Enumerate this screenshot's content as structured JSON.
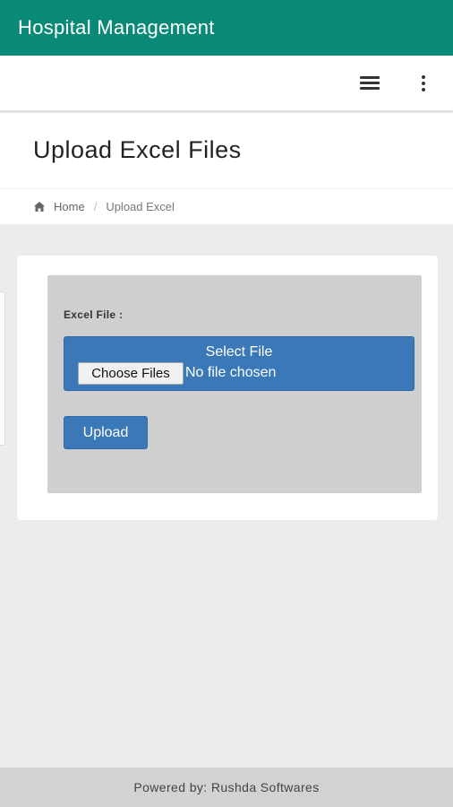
{
  "app_bar": {
    "title": "Hospital Management"
  },
  "toolbar": {
    "menu_icon": "hamburger-menu-icon",
    "more_icon": "more-vertical-icon"
  },
  "page": {
    "title": "Upload Excel Files"
  },
  "breadcrumb": {
    "home_icon": "home-icon",
    "home": "Home",
    "separator": "/",
    "current": "Upload Excel"
  },
  "form": {
    "label": "Excel File :",
    "file_input_title": "Select File",
    "choose_button": "Choose Files",
    "no_file_text": "No file chosen",
    "upload_button": "Upload"
  },
  "footer": {
    "text": "Powered by: Rushda Softwares"
  },
  "colors": {
    "app_bar": "#0a8a76",
    "primary_button": "#3a78b8",
    "panel": "#cfcfcf",
    "background": "#ececec",
    "footer": "#d2d2d2"
  }
}
